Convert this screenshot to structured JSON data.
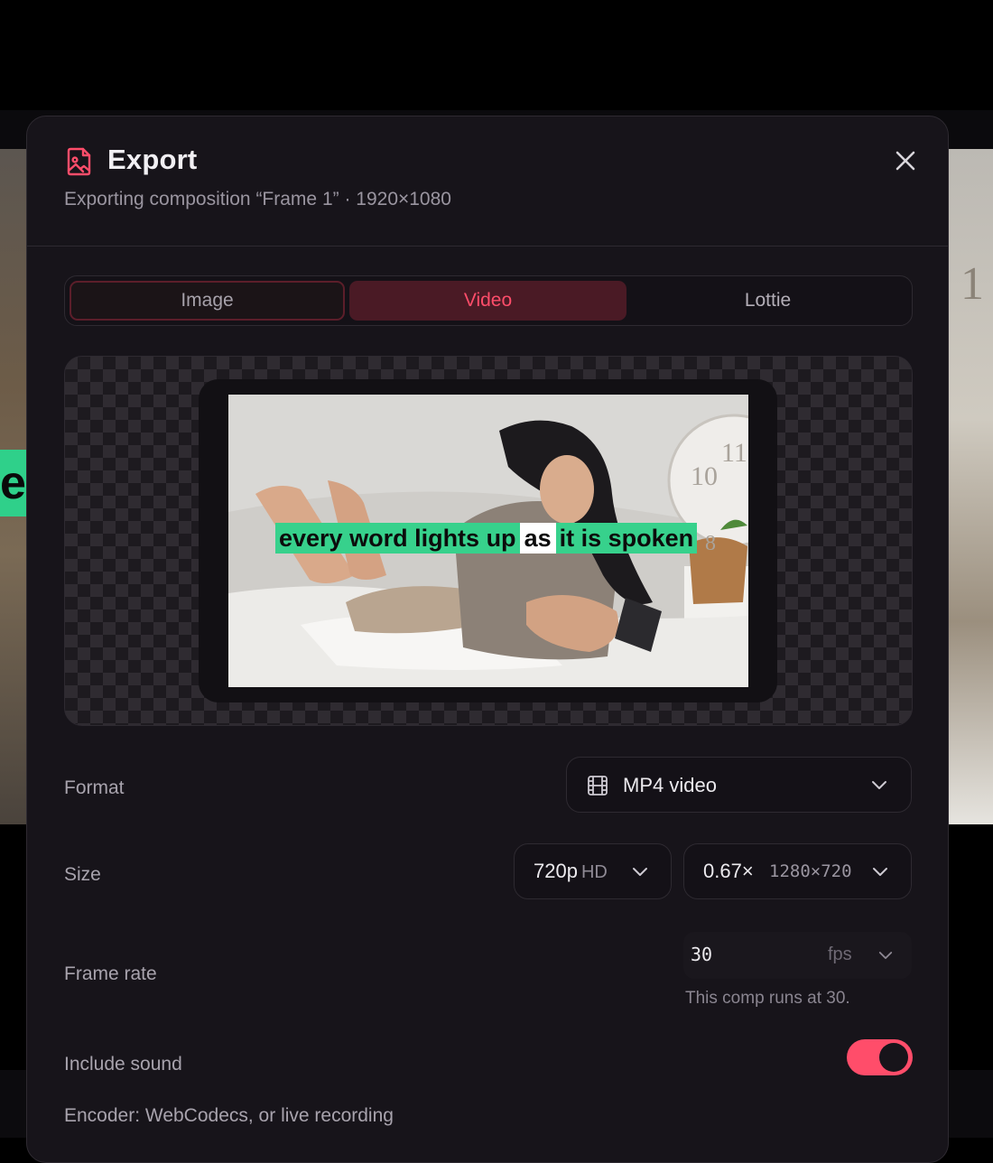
{
  "background": {
    "canvas_letter": "e",
    "right_canvas_text": "1"
  },
  "modal": {
    "title": "Export",
    "subtitle": "Exporting composition “Frame 1” · 1920×1080",
    "icons": {
      "title": "file-image-icon",
      "close": "close-icon"
    }
  },
  "tabs": [
    {
      "label": "Image",
      "state": "outlined"
    },
    {
      "label": "Video",
      "state": "selected"
    },
    {
      "label": "Lottie",
      "state": "default"
    }
  ],
  "preview": {
    "caption": {
      "before": "every word lights up",
      "active": "as",
      "after": "it is spoken"
    },
    "clock_numbers": [
      "11",
      "10",
      "8"
    ]
  },
  "format": {
    "label": "Format",
    "value": "MP4 video",
    "icon": "film-icon"
  },
  "size": {
    "label": "Size",
    "preset": "720p",
    "preset_suffix": "HD",
    "scale": "0.67×",
    "resolution": "1280×720"
  },
  "frame_rate": {
    "label": "Frame rate",
    "value": "30",
    "unit": "fps",
    "hint": "This comp runs at 30."
  },
  "sound": {
    "label": "Include sound",
    "enabled": true
  },
  "encoder": "Encoder: WebCodecs, or live recording",
  "colors": {
    "accent": "#ff4d6a",
    "accent_bg": "#4a1a25",
    "caption_highlight": "#37d18c",
    "modal_bg": "#17141a"
  }
}
